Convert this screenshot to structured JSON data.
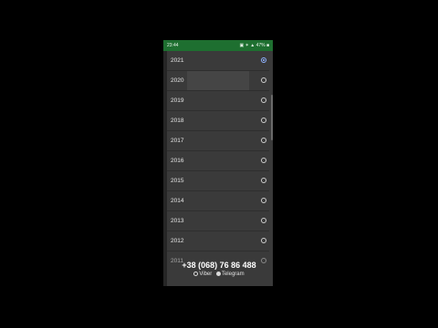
{
  "status_bar": {
    "time": "23:44",
    "right_text": "▣ ✶ ▲ 47% ■"
  },
  "year_list": {
    "items": [
      {
        "label": "2021",
        "selected": true
      },
      {
        "label": "2020",
        "selected": false
      },
      {
        "label": "2019",
        "selected": false
      },
      {
        "label": "2018",
        "selected": false
      },
      {
        "label": "2017",
        "selected": false
      },
      {
        "label": "2016",
        "selected": false
      },
      {
        "label": "2015",
        "selected": false
      },
      {
        "label": "2014",
        "selected": false
      },
      {
        "label": "2013",
        "selected": false
      },
      {
        "label": "2012",
        "selected": false
      },
      {
        "label": "2011",
        "selected": false
      }
    ]
  },
  "overlay": {
    "phone_number": "+38 (068) 76 86 488",
    "viber_label": "Viber",
    "telegram_label": "Telegram"
  },
  "colors": {
    "status_bar": "#1e6f30",
    "dialog_bg": "#3a3a3a",
    "radio_selected": "#8fb3ff"
  }
}
